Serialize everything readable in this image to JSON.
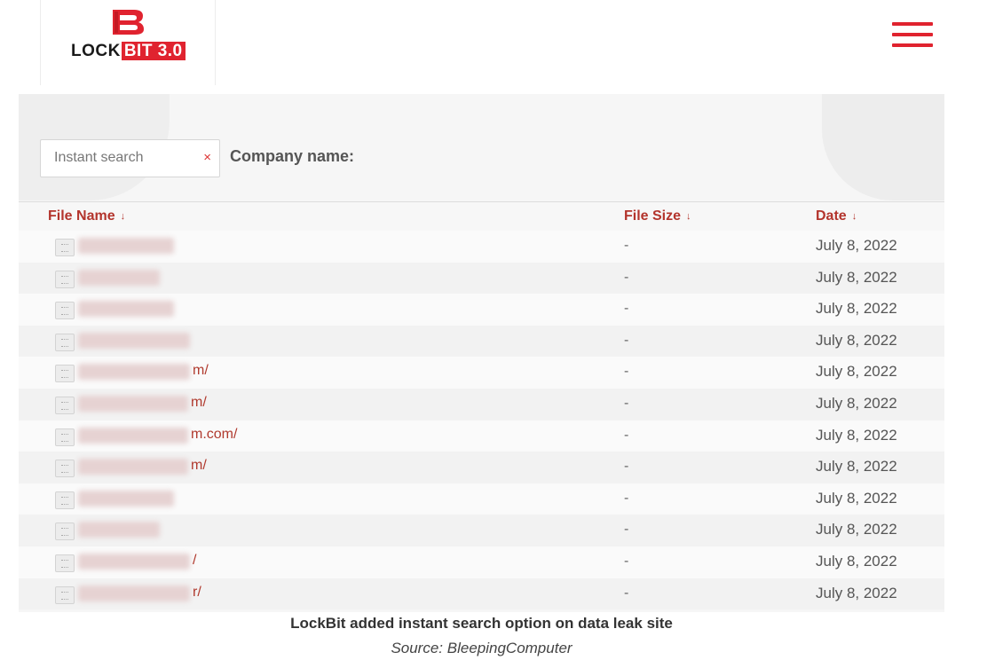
{
  "brand": {
    "logo_text_dark": "LOCK",
    "logo_text_highlight": "BIT 3.0",
    "accent_color": "#e0232f"
  },
  "header": {
    "menu_icon": "hamburger-menu-icon"
  },
  "search": {
    "placeholder": "Instant search",
    "value": "",
    "clear_label": "×",
    "company_label": "Company name:"
  },
  "table": {
    "columns": [
      {
        "label": "File Name",
        "sort_glyph": "↓"
      },
      {
        "label": "File Size",
        "sort_glyph": "↓"
      },
      {
        "label": "Date",
        "sort_glyph": "↓"
      }
    ],
    "rows": [
      {
        "name_visible": "",
        "size": "-",
        "date": "July 8, 2022"
      },
      {
        "name_visible": "",
        "size": "-",
        "date": "July 8, 2022"
      },
      {
        "name_visible": "",
        "size": "-",
        "date": "July 8, 2022"
      },
      {
        "name_visible": "",
        "size": "-",
        "date": "July 8, 2022"
      },
      {
        "name_visible": "m/",
        "size": "-",
        "date": "July 8, 2022"
      },
      {
        "name_visible": "m/",
        "size": "-",
        "date": "July 8, 2022"
      },
      {
        "name_visible": "m.com/",
        "size": "-",
        "date": "July 8, 2022"
      },
      {
        "name_visible": "m/",
        "size": "-",
        "date": "July 8, 2022"
      },
      {
        "name_visible": "",
        "size": "-",
        "date": "July 8, 2022"
      },
      {
        "name_visible": "",
        "size": "-",
        "date": "July 8, 2022"
      },
      {
        "name_visible": "/",
        "size": "-",
        "date": "July 8, 2022"
      },
      {
        "name_visible": "r/",
        "size": "-",
        "date": "July 8, 2022"
      }
    ]
  },
  "caption": {
    "title": "LockBit added instant search option on data leak site",
    "source": "Source: BleepingComputer"
  }
}
